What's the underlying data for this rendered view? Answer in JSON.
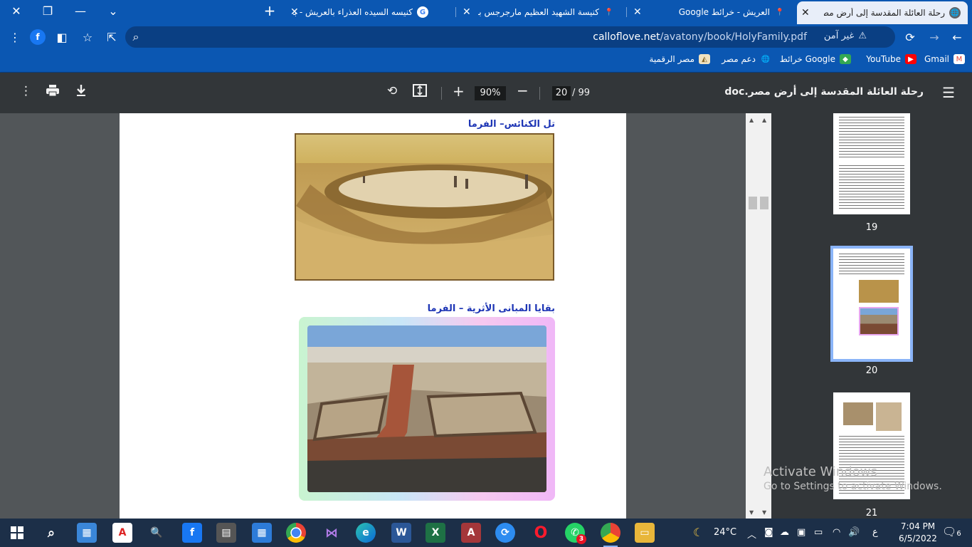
{
  "browser": {
    "tabs": [
      {
        "title": "رحلة العائلة المقدسة إلى أرض مصر",
        "active": true
      },
      {
        "title": "العريش - خرائط Google",
        "active": false
      },
      {
        "title": "كنيسة الشهيد العظيم مارجرجس بالع",
        "active": false
      },
      {
        "title": "كنيسه السيده العذراء بالعريش - بحث",
        "active": false
      }
    ],
    "new_tab_label": "+",
    "tab_search": "⌄",
    "minimize": "—",
    "restore": "❐",
    "close": "✕",
    "security_text": "غير آمن",
    "url_host": "calloflove.net",
    "url_path": "/avatony/book/HolyFamily.pdf",
    "profile_initial": "f"
  },
  "bookmarks": [
    {
      "label": "Gmail",
      "icon": "gmail-icon",
      "color": "#ea4335"
    },
    {
      "label": "YouTube",
      "icon": "youtube-icon",
      "color": "#ff0000"
    },
    {
      "label": "خرائط Google",
      "icon": "maps-icon",
      "color": "#34a853"
    },
    {
      "label": "دعم مصر",
      "icon": "globe-icon",
      "color": "#ffffff"
    },
    {
      "label": "مصر الرقمية",
      "icon": "egypt-digital-icon",
      "color": "#d9b36a"
    }
  ],
  "pdf": {
    "title": "رحلة العائلة المقدسة إلى أرض مصر.doc",
    "current_page": "20",
    "total_pages": "/ 99",
    "zoom": "90%",
    "captions": {
      "top": "تل الكنائس– الفرما",
      "bottom": "بقايا المبانى الأثرية – الفرما"
    },
    "thumbnails": [
      {
        "number": "19",
        "selected": false
      },
      {
        "number": "20",
        "selected": true
      },
      {
        "number": "21",
        "selected": false
      }
    ]
  },
  "watermark": {
    "line1": "Activate Windows",
    "line2": "Go to Settings to activate Windows."
  },
  "taskbar": {
    "weather": "24°C",
    "time": "7:04 PM",
    "date": "6/5/2022",
    "language": "ع",
    "whatsapp_badge": "3",
    "notifications": "6"
  }
}
